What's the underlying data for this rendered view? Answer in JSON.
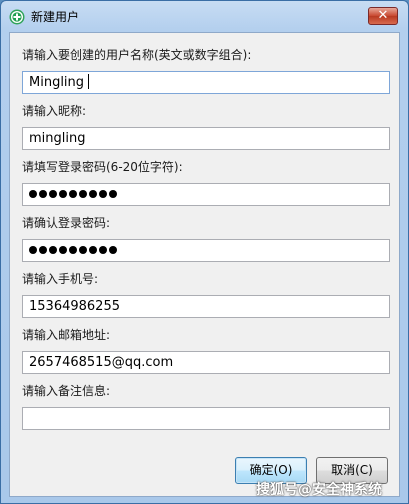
{
  "window": {
    "title": "新建用户",
    "close_label": "✕"
  },
  "fields": [
    {
      "label": "请输入要创建的用户名称(英文或数字组合):",
      "value": "Mingling",
      "focused": true
    },
    {
      "label": "请输入昵称:",
      "value": "mingling"
    },
    {
      "label": "请填写登录密码(6-20位字符):",
      "value": "",
      "masked_count": 9
    },
    {
      "label": "请确认登录密码:",
      "value": "",
      "masked_count": 9
    },
    {
      "label": "请输入手机号:",
      "value": "15364986255"
    },
    {
      "label": "请输入邮箱地址:",
      "value": "2657468515@qq.com"
    },
    {
      "label": "请输入备注信息:",
      "value": ""
    }
  ],
  "buttons": {
    "ok_label": "确定(O)",
    "cancel_label": "取消(C)"
  },
  "watermark": "搜狐号@安全神系统",
  "colors": {
    "title_bar": "#b3cfee",
    "close_button": "#c8472f",
    "client_bg": "#f0f0f0"
  }
}
